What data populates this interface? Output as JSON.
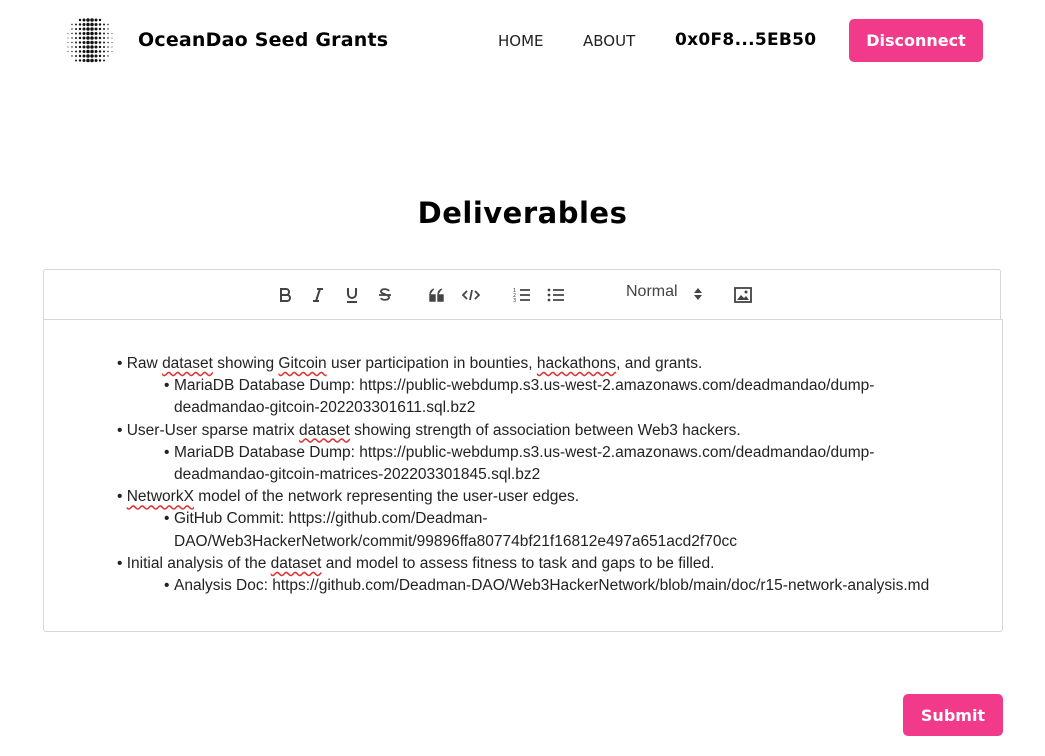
{
  "header": {
    "brand": "OceanDao Seed Grants",
    "nav": [
      "HOME",
      "ABOUT"
    ],
    "wallet": "0x0F8...5EB50",
    "disconnect_label": "Disconnect"
  },
  "page": {
    "title": "Deliverables"
  },
  "toolbar": {
    "header_select_value": "Normal",
    "buttons": [
      "bold-icon",
      "italic-icon",
      "underline-icon",
      "strike-icon",
      "blockquote-icon",
      "code-block-icon",
      "ordered-list-icon",
      "bullet-list-icon",
      "image-icon"
    ]
  },
  "editor": {
    "items": [
      {
        "pre": "Raw ",
        "w1": "dataset",
        "mid1": " showing ",
        "w2": "Gitcoin",
        "mid2": " user participation in bounties, ",
        "w3": "hackathons",
        "post": ", and grants.",
        "sub": "MariaDB Database Dump: https://public-webdump.s3.us-west-2.amazonaws.com/deadmandao/dump-deadmandao-gitcoin-202203301611.sql.bz2"
      },
      {
        "pre": "User-User sparse matrix ",
        "w1": "dataset",
        "post": " showing strength of association between Web3 hackers.",
        "sub": "MariaDB Database Dump: https://public-webdump.s3.us-west-2.amazonaws.com/deadmandao/dump-deadmandao-gitcoin-matrices-202203301845.sql.bz2"
      },
      {
        "w1": "NetworkX",
        "post": " model of the network representing the user-user edges.",
        "sub": "GitHub Commit: https://github.com/Deadman-DAO/Web3HackerNetwork/commit/99896ffa80774bf21f16812e497a651acd2f70cc"
      },
      {
        "pre": "Initial analysis of the ",
        "w1": "dataset",
        "post": " and model to assess fitness to task and gaps to be filled.",
        "sub": "Analysis Doc: https://github.com/Deadman-DAO/Web3HackerNetwork/blob/main/doc/r15-network-analysis.md"
      }
    ]
  },
  "actions": {
    "submit_label": "Submit"
  },
  "colors": {
    "accent": "#f23a8a",
    "border": "#d6d6d6"
  }
}
